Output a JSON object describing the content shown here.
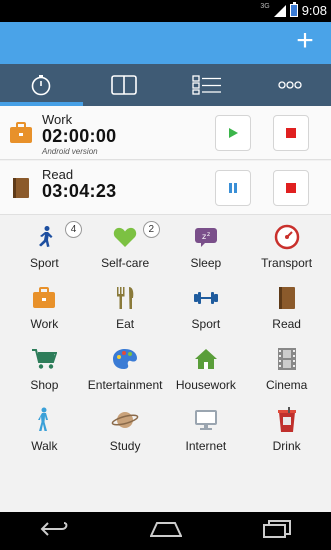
{
  "status_bar": {
    "network": "3G",
    "time": "9:08"
  },
  "action_bar": {
    "add_label": "+"
  },
  "tabs": [
    {
      "icon": "stopwatch-icon",
      "active": true
    },
    {
      "icon": "book-icon",
      "active": false
    },
    {
      "icon": "list-icon",
      "active": false
    },
    {
      "icon": "more-icon",
      "active": false
    }
  ],
  "trackers": [
    {
      "name": "Work",
      "time": "02:00:00",
      "note": "Android version",
      "icon": "briefcase-icon",
      "state": "stopped"
    },
    {
      "name": "Read",
      "time": "03:04:23",
      "note": "",
      "icon": "book-icon",
      "state": "running"
    }
  ],
  "activities": [
    {
      "label": "Sport",
      "icon": "runner-icon",
      "color": "#1e4fa0",
      "badge": "4"
    },
    {
      "label": "Self-care",
      "icon": "heart-icon",
      "color": "#7cc142",
      "badge": "2"
    },
    {
      "label": "Sleep",
      "icon": "sleep-icon",
      "color": "#7a4f8a",
      "badge": ""
    },
    {
      "label": "Transport",
      "icon": "gauge-icon",
      "color": "#c9302c",
      "badge": ""
    },
    {
      "label": "Work",
      "icon": "briefcase-icon",
      "color": "#e8912a",
      "badge": ""
    },
    {
      "label": "Eat",
      "icon": "fork-knife-icon",
      "color": "#8a7a3a",
      "badge": ""
    },
    {
      "label": "Sport",
      "icon": "dumbbell-icon",
      "color": "#1f5c9e",
      "badge": ""
    },
    {
      "label": "Read",
      "icon": "book-icon",
      "color": "#8b5a2b",
      "badge": ""
    },
    {
      "label": "Shop",
      "icon": "cart-icon",
      "color": "#2e7d5a",
      "badge": ""
    },
    {
      "label": "Entertainment",
      "icon": "palette-icon",
      "color": "#3a7bd5",
      "badge": ""
    },
    {
      "label": "Housework",
      "icon": "house-icon",
      "color": "#5a9e3a",
      "badge": ""
    },
    {
      "label": "Cinema",
      "icon": "film-icon",
      "color": "#888888",
      "badge": ""
    },
    {
      "label": "Walk",
      "icon": "walker-icon",
      "color": "#3aa0d8",
      "badge": ""
    },
    {
      "label": "Study",
      "icon": "planet-icon",
      "color": "#c9a27a",
      "badge": ""
    },
    {
      "label": "Internet",
      "icon": "monitor-icon",
      "color": "#9aa5b0",
      "badge": ""
    },
    {
      "label": "Drink",
      "icon": "drink-icon",
      "color": "#c0302c",
      "badge": ""
    }
  ],
  "colors": {
    "action_bar": "#4aa3e8",
    "tab_bar": "#3f5b75",
    "play": "#3bb54a",
    "stop": "#e02020",
    "pause": "#3a8fd6"
  }
}
